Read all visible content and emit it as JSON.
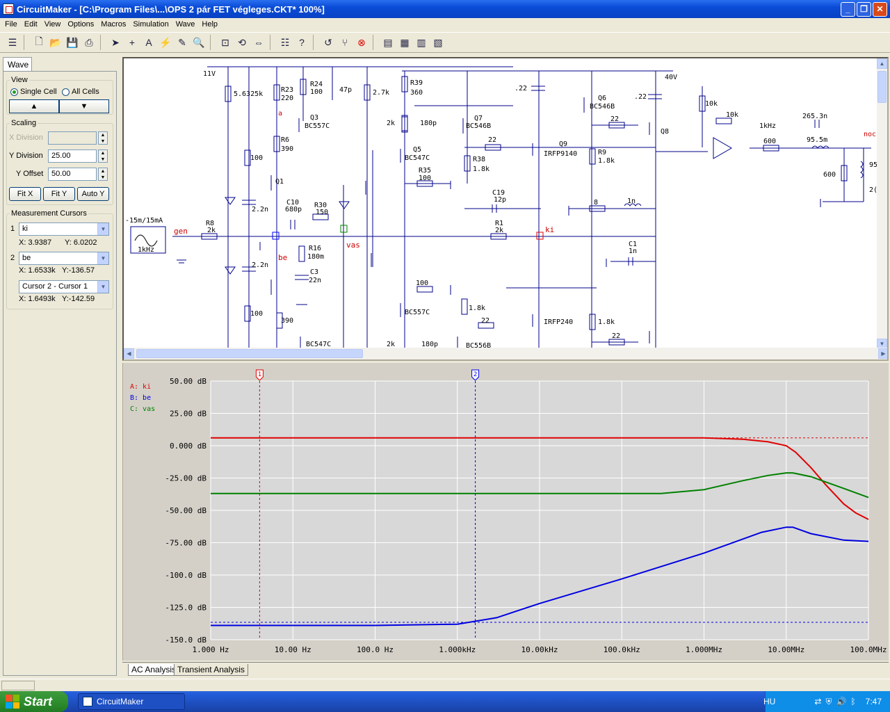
{
  "window": {
    "title": "CircuitMaker - [C:\\Program Files\\...\\OPS 2 pár FET végleges.CKT* 100%]"
  },
  "menu": [
    "File",
    "Edit",
    "View",
    "Options",
    "Macros",
    "Simulation",
    "Wave",
    "Help"
  ],
  "panel": {
    "tab": "Wave",
    "view": {
      "legend": "View",
      "single_cell": "Single Cell",
      "all_cells": "All Cells",
      "up": "▲",
      "down": "▼"
    },
    "scaling": {
      "legend": "Scaling",
      "x_division": "X Division",
      "x_division_value": "",
      "y_division": "Y Division",
      "y_division_value": "25.00",
      "y_offset": "Y Offset",
      "y_offset_value": "50.00",
      "fit_x": "Fit X",
      "fit_y": "Fit Y",
      "auto_y": "Auto Y"
    },
    "cursors": {
      "legend": "Measurement Cursors",
      "c1": {
        "num": "1",
        "node": "ki",
        "x": "X: 3.9387",
        "y": "Y: 6.0202"
      },
      "c2": {
        "num": "2",
        "node": "be",
        "x": "X: 1.6533k",
        "y": "Y:-136.57"
      },
      "diff": {
        "label": "Cursor 2 - Cursor 1",
        "x": "X: 1.6493k",
        "y": "Y:-142.59"
      }
    }
  },
  "schematic": {
    "labels": {
      "v11": "11V",
      "v40": "40V",
      "src": "-15m/15mA",
      "src_f": "1kHz",
      "gen": "gen",
      "be": "be",
      "ki": "ki",
      "vas": "vas",
      "a": "a",
      "node": "noc",
      "f1k": "1kHz"
    },
    "parts": [
      {
        "n": "R23",
        "v": "220"
      },
      {
        "n": "R24",
        "v": "100"
      },
      {
        "n": "C_47p",
        "v": "47p"
      },
      {
        "n": "R_2k7",
        "v": "2.7k"
      },
      {
        "n": "R39",
        "v": "360"
      },
      {
        "n": "Q3",
        "v": "BC557C"
      },
      {
        "n": "Q7",
        "v": "BC546B"
      },
      {
        "n": "Q6",
        "v": "BC546B"
      },
      {
        "n": "Q5",
        "v": "BC547C"
      },
      {
        "n": "Q9",
        "v": "IRFP9140"
      },
      {
        "n": "R6",
        "v": "390"
      },
      {
        "n": "R38",
        "v": "1.8k"
      },
      {
        "n": "R9",
        "v": "1.8k"
      },
      {
        "n": "R35",
        "v": "100"
      },
      {
        "n": "C10",
        "v": "680p"
      },
      {
        "n": "R30",
        "v": "150"
      },
      {
        "n": "C19",
        "v": "12p"
      },
      {
        "n": "R8",
        "v": "2k"
      },
      {
        "n": "R1",
        "v": "2k"
      },
      {
        "n": "R16",
        "v": "180m"
      },
      {
        "n": "C3",
        "v": "22n"
      },
      {
        "n": "C1",
        "v": "1n"
      },
      {
        "n": "Q1",
        "v": ""
      },
      {
        "n": "Q8",
        "v": ""
      },
      {
        "n": "R_5m",
        "v": "5.6325k"
      },
      {
        "n": "IRFP240",
        "v": "IRFP240"
      },
      {
        "n": "BC557C_2",
        "v": "BC557C"
      },
      {
        "n": "BC547C_2",
        "v": "BC547C"
      },
      {
        "n": "BC556B",
        "v": "BC556B"
      }
    ],
    "misc": {
      "c22a": ".22",
      "c22b": ".22",
      "r22a": "22",
      "r22b": "22",
      "r22c": "22",
      "r22d": "22",
      "r2k_a": "2k",
      "r2k_b": "2k",
      "c180a": "180p",
      "c180b": "180p",
      "r100a": "100",
      "r100b": "100",
      "r100c": "100",
      "c2n2a": "2.2n",
      "c2n2b": "2.2n",
      "r390": "390",
      "r1k8a": "1.8k",
      "r1k8b": "1.8k",
      "r8": "8",
      "l1n": "1n",
      "r10ka": "10k",
      "r10kb": "10k",
      "c265": "265.3n",
      "l95": "95.5m",
      "r600a": "600",
      "r600b": "600",
      "r95": "95",
      "c2": "2("
    }
  },
  "graph": {
    "legend": [
      {
        "key": "A: ki",
        "color": "#e00000"
      },
      {
        "key": "B: be",
        "color": "#0000e0"
      },
      {
        "key": "C: vas",
        "color": "#008000"
      }
    ],
    "cursor1": "1",
    "cursor2": "2",
    "tabs": [
      "AC Analysis",
      "Transient Analysis"
    ]
  },
  "chart_data": {
    "type": "line",
    "xscale": "log",
    "xlim": [
      1,
      100000000
    ],
    "ylim": [
      -150,
      50
    ],
    "x_ticks": [
      "1.000 Hz",
      "10.00 Hz",
      "100.0 Hz",
      "1.000kHz",
      "10.00kHz",
      "100.0kHz",
      "1.000MHz",
      "10.00MHz",
      "100.0MHz"
    ],
    "y_ticks": [
      "50.00 dB",
      "25.00 dB",
      "0.000 dB",
      "-25.00 dB",
      "-50.00 dB",
      "-75.00 dB",
      "-100.0 dB",
      "-125.0 dB",
      "-150.0 dB"
    ],
    "cursors": {
      "c1_x": 3.9387,
      "c2_x": 1653.3,
      "c1_y": 6.0202,
      "c2_y": -136.57
    },
    "series": [
      {
        "name": "A: ki",
        "color": "#e00000",
        "x": [
          1,
          1000,
          100000,
          1000000,
          3000000,
          6000000,
          10000000,
          13000000,
          20000000,
          30000000,
          50000000,
          70000000,
          100000000
        ],
        "y": [
          6,
          6,
          6,
          6,
          5,
          3,
          0,
          -5,
          -17,
          -30,
          -45,
          -52,
          -57
        ]
      },
      {
        "name": "B: be",
        "color": "#0000e0",
        "x": [
          1,
          100,
          1000,
          3000,
          10000,
          100000,
          1000000,
          5000000,
          10000000,
          12000000,
          20000000,
          50000000,
          100000000
        ],
        "y": [
          -139,
          -139,
          -138,
          -133,
          -122,
          -103,
          -83,
          -67,
          -63,
          -63,
          -68,
          -73,
          -74
        ]
      },
      {
        "name": "C: vas",
        "color": "#008000",
        "x": [
          1,
          1000,
          100000,
          300000,
          1000000,
          3000000,
          6000000,
          10000000,
          12000000,
          20000000,
          50000000,
          100000000
        ],
        "y": [
          -37,
          -37,
          -37,
          -37,
          -34,
          -27,
          -23,
          -21,
          -21,
          -24,
          -33,
          -40
        ]
      }
    ]
  },
  "status": {
    "left": ""
  },
  "taskbar": {
    "start": "Start",
    "item": "CircuitMaker",
    "lang": "HU",
    "clock": "7:47"
  }
}
